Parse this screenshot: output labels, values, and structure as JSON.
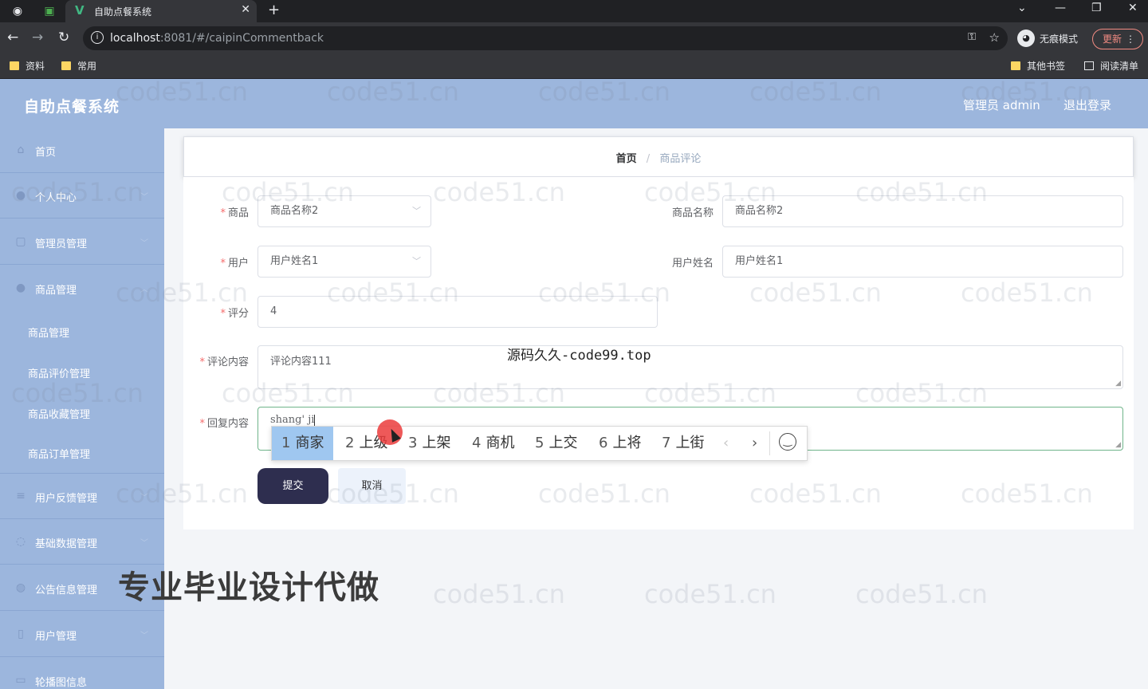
{
  "browser": {
    "tab_title": "自助点餐系统",
    "new_tab_symbol": "+",
    "url_host": "localhost",
    "url_rest": ":8081/#/caipinCommentback",
    "incognito_label": "无痕模式",
    "update_label": "更新",
    "bookmarks": [
      "资料",
      "常用"
    ],
    "other_bookmarks": "其他书签",
    "reading_list": "阅读清单"
  },
  "header": {
    "title": "自助点餐系统",
    "admin": "管理员 admin",
    "logout": "退出登录"
  },
  "sidebar": {
    "items": [
      {
        "label": "首页"
      },
      {
        "label": "个人中心"
      },
      {
        "label": "管理员管理"
      },
      {
        "label": "商品管理"
      },
      {
        "label": "用户反馈管理"
      },
      {
        "label": "基础数据管理"
      },
      {
        "label": "公告信息管理"
      },
      {
        "label": "用户管理"
      },
      {
        "label": "轮播图信息"
      }
    ],
    "sub_items": [
      {
        "label": "商品管理"
      },
      {
        "label": "商品评价管理"
      },
      {
        "label": "商品收藏管理"
      },
      {
        "label": "商品订单管理"
      }
    ]
  },
  "breadcrumb": {
    "home": "首页",
    "separator": "/",
    "current": "商品评论"
  },
  "form": {
    "required_mark": "*",
    "product_label": "商品",
    "product_value": "商品名称2",
    "product_name_label": "商品名称",
    "product_name_value": "商品名称2",
    "user_label": "用户",
    "user_value": "用户姓名1",
    "user_name_label": "用户姓名",
    "user_name_value": "用户姓名1",
    "score_label": "评分",
    "score_value": "4",
    "comment_label": "评论内容",
    "comment_value": "评论内容111",
    "reply_label": "回复内容",
    "reply_typing": "shang' ji",
    "submit": "提交",
    "cancel": "取消"
  },
  "ime": {
    "candidates": [
      {
        "n": "1",
        "text": "商家"
      },
      {
        "n": "2",
        "text": "上级"
      },
      {
        "n": "3",
        "text": "上架"
      },
      {
        "n": "4",
        "text": "商机"
      },
      {
        "n": "5",
        "text": "上交"
      },
      {
        "n": "6",
        "text": "上将"
      },
      {
        "n": "7",
        "text": "上街"
      }
    ]
  },
  "overlay": {
    "caption": "源码久久-code99.top",
    "promo": "专业毕业设计代做",
    "watermark": "code51.cn"
  }
}
